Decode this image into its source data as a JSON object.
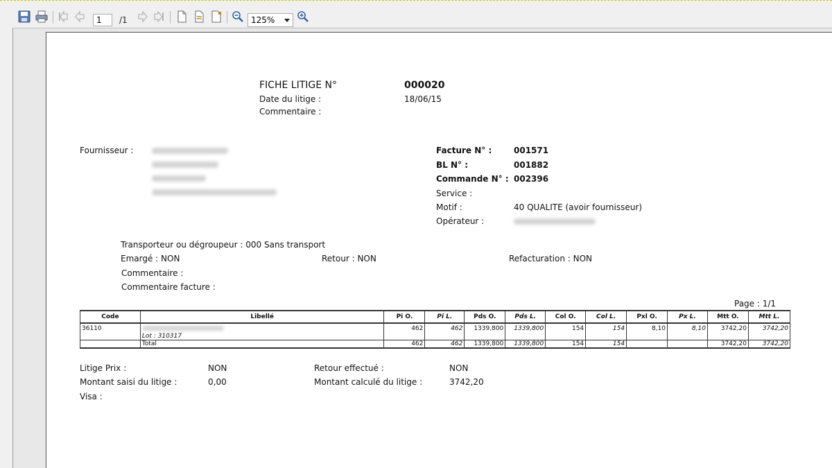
{
  "toolbar": {
    "page_current": "1",
    "page_total": "/1",
    "zoom": "125%"
  },
  "header": {
    "title": "FICHE LITIGE N°",
    "number": "000020",
    "date_label": "Date du litige :",
    "date_value": "18/06/15",
    "comment_label": "Commentaire :"
  },
  "supplier": {
    "label": "Fournisseur :"
  },
  "refs": {
    "facture_label": "Facture N° :",
    "facture_value": "001571",
    "bl_label": "BL N° :",
    "bl_value": "001882",
    "commande_label": "Commande N° :",
    "commande_value": "002396",
    "service_label": "Service :",
    "motif_label": "Motif :",
    "motif_value": "40 QUALITE (avoir fournisseur)",
    "operateur_label": "Opérateur :"
  },
  "transport": {
    "transporteur": "Transporteur ou dégroupeur : 000 Sans transport",
    "emarge": "Emargé : NON",
    "retour": "Retour : NON",
    "refacturation": "Refacturation : NON",
    "commentaire": "Commentaire :",
    "commentaire_facture": "Commentaire facture :"
  },
  "page_indicator": "Page : 1/1",
  "table": {
    "headers": [
      "Code",
      "Libellé",
      "Pi O.",
      "Pi L.",
      "Pds O.",
      "Pds L.",
      "Col O.",
      "Col L.",
      "Pxl O.",
      "Px L.",
      "Mtt O.",
      "Mtt L."
    ],
    "row": {
      "code": "36110",
      "lot": "Lot : 310317",
      "pi_o": "462",
      "pi_l": "462",
      "pds_o": "1339,800",
      "pds_l": "1339,800",
      "col_o": "154",
      "col_l": "154",
      "pxl_o": "8,10",
      "px_l": "8,10",
      "mtt_o": "3742,20",
      "mtt_l": "3742,20"
    },
    "total": {
      "label": "Total",
      "pi_o": "462",
      "pi_l": "462",
      "pds_o": "1339,800",
      "pds_l": "1339,800",
      "col_o": "154",
      "col_l": "154",
      "mtt_o": "3742,20",
      "mtt_l": "3742,20"
    }
  },
  "footer": {
    "litige_prix_label": "Litige Prix :",
    "litige_prix_value": "NON",
    "montant_saisi_label": "Montant saisi du litige :",
    "montant_saisi_value": "0,00",
    "visa_label": "Visa :",
    "retour_effectue_label": "Retour effectué :",
    "retour_effectue_value": "NON",
    "montant_calcule_label": "Montant calculé du litige :",
    "montant_calcule_value": "3742,20"
  }
}
